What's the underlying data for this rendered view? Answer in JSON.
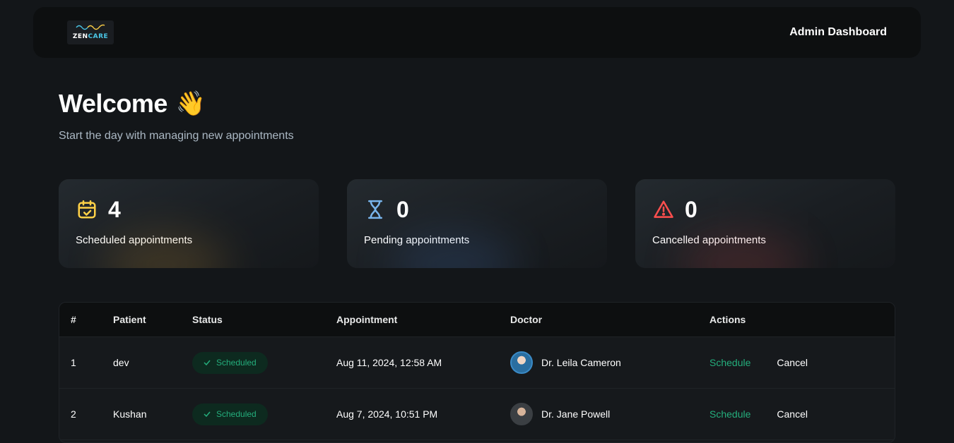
{
  "header": {
    "logo": {
      "text_main": "ZEN",
      "text_accent": "CARE"
    },
    "title": "Admin Dashboard"
  },
  "welcome": {
    "title": "Welcome",
    "emoji": "👋",
    "subtitle": "Start the day with managing new appointments"
  },
  "stats": [
    {
      "value": "4",
      "label": "Scheduled appointments",
      "icon": "calendar-check-icon",
      "color": "#ffd147"
    },
    {
      "value": "0",
      "label": "Pending appointments",
      "icon": "hourglass-icon",
      "color": "#79b5ec"
    },
    {
      "value": "0",
      "label": "Cancelled appointments",
      "icon": "alert-triangle-icon",
      "color": "#ff4f4e"
    }
  ],
  "table": {
    "headers": [
      "#",
      "Patient",
      "Status",
      "Appointment",
      "Doctor",
      "Actions"
    ],
    "rows": [
      {
        "num": "1",
        "patient": "dev",
        "status": "Scheduled",
        "appointment": "Aug 11, 2024, 12:58 AM",
        "doctor": "Dr. Leila Cameron",
        "action_schedule": "Schedule",
        "action_cancel": "Cancel"
      },
      {
        "num": "2",
        "patient": "Kushan",
        "status": "Scheduled",
        "appointment": "Aug 7, 2024, 10:51 PM",
        "doctor": "Dr. Jane Powell",
        "action_schedule": "Schedule",
        "action_cancel": "Cancel"
      }
    ]
  },
  "colors": {
    "accent_green": "#24ae7c",
    "background": "#131619"
  }
}
